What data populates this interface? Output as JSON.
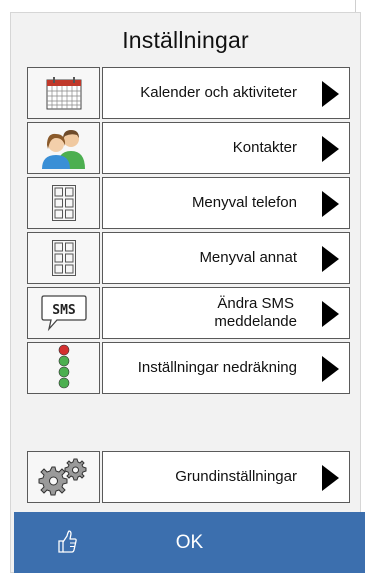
{
  "title": "Inställningar",
  "items": [
    {
      "label": "Kalender och aktiviteter",
      "icon": "calendar-icon"
    },
    {
      "label": "Kontakter",
      "icon": "contacts-icon"
    },
    {
      "label": "Menyval telefon",
      "icon": "grid-icon"
    },
    {
      "label": "Menyval annat",
      "icon": "grid-icon"
    },
    {
      "label": "Ändra SMS\nmeddelande",
      "icon": "sms-icon",
      "sms_text": "SMS"
    },
    {
      "label": "Inställningar nedräkning",
      "icon": "traffic-light-icon"
    },
    {
      "label": "Grundinställningar",
      "icon": "gears-icon"
    }
  ],
  "ok": {
    "label": "OK",
    "icon": "thumbs-up-icon"
  },
  "colors": {
    "ok_bar": "#3c6fae",
    "calendar_accent": "#c0392b",
    "green_light": "#4caf50",
    "red_light": "#d32f2f"
  }
}
